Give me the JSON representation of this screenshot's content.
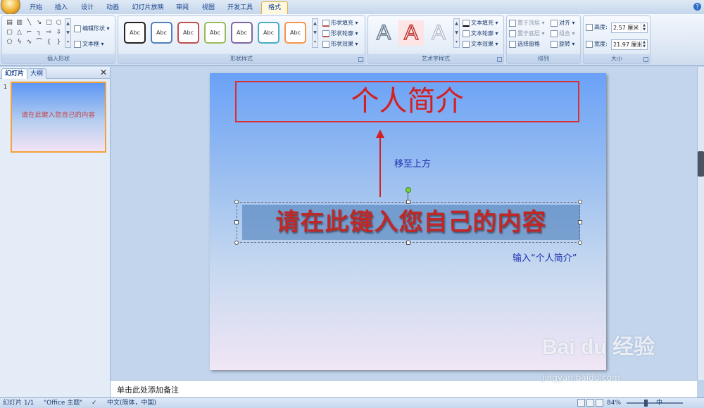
{
  "ribbon_tabs": [
    {
      "label": "开始"
    },
    {
      "label": "插入"
    },
    {
      "label": "设计"
    },
    {
      "label": "动画"
    },
    {
      "label": "幻灯片放映"
    },
    {
      "label": "审阅"
    },
    {
      "label": "视图"
    },
    {
      "label": "开发工具"
    },
    {
      "label": "格式"
    }
  ],
  "active_tab": "格式",
  "groups": {
    "insert_shapes": {
      "label": "插入形状",
      "edit_shape": "编辑形状",
      "text_box": "文本框"
    },
    "shape_styles": {
      "label": "形状样式",
      "sample_text": "Abc",
      "fill": "形状填充",
      "outline": "形状轮廓",
      "effects": "形状效果",
      "style_colors": [
        "#222222",
        "#4f81bd",
        "#c0504d",
        "#9bbb59",
        "#8064a2",
        "#4bacc6",
        "#f79646"
      ]
    },
    "wordart": {
      "label": "艺术字样式",
      "glyph": "A",
      "text_fill": "文本填充",
      "text_outline": "文本轮廓",
      "text_effects": "文本效果"
    },
    "arrange": {
      "label": "排列",
      "bring_front": "置于顶层",
      "send_back": "置于底层",
      "selection_pane": "选择窗格",
      "align": "对齐",
      "group": "组合",
      "rotate": "旋转"
    },
    "size": {
      "label": "大小",
      "height_label": "高度:",
      "height_value": "2.57 厘米",
      "width_label": "宽度:",
      "width_value": "21.97 厘米"
    }
  },
  "left_pane": {
    "tab_slides": "幻灯片",
    "tab_outline": "大纲",
    "close": "✕",
    "slide_number": "1",
    "thumb_text": "请在此键入您自己的内容"
  },
  "slide": {
    "title": "个人简介",
    "annotation_move": "移至上方",
    "content": "请在此键入您自己的内容",
    "annotation_input": "输入“个人简介”"
  },
  "notes_placeholder": "单击此处添加备注",
  "status": {
    "slide_count": "幻灯片 1/1",
    "theme": "\"Office 主题\"",
    "language": "中文(简体，中国)",
    "zoom": "84%",
    "ime": "中"
  },
  "watermark": {
    "logo": "Bai du 经验",
    "url": "jingyan.baidu.com"
  }
}
